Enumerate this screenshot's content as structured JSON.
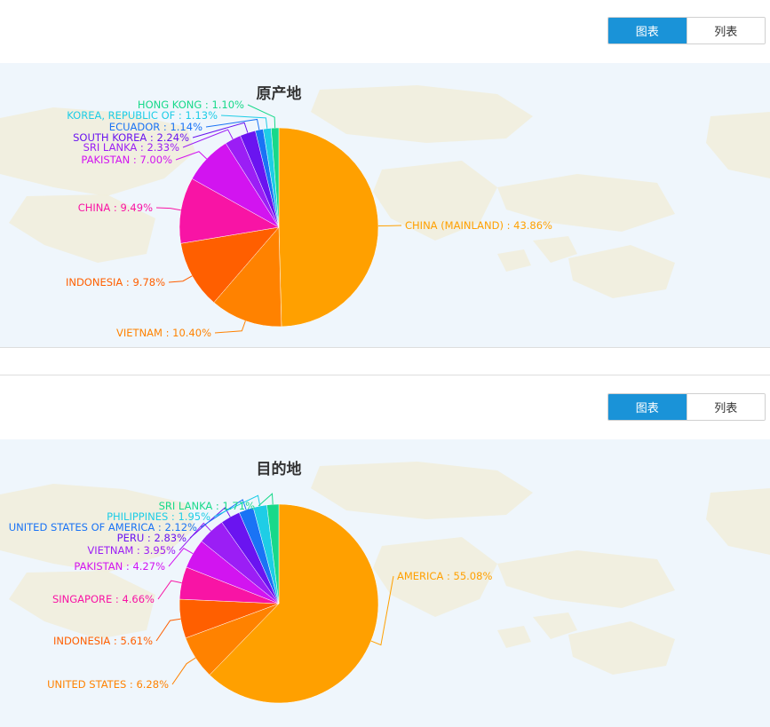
{
  "view_toggle": {
    "chart_label": "图表",
    "list_label": "列表"
  },
  "colors": {
    "accent": "#1a93d8",
    "panel_bg": "#eff6fc",
    "map_land": "#f1eedd"
  },
  "chart_data": [
    {
      "type": "pie",
      "title": "原产地",
      "slices": [
        {
          "label": "CHINA (MAINLAND)",
          "value": 43.86,
          "display": "CHINA (MAINLAND) : 43.86%",
          "color": "#ffa000"
        },
        {
          "label": "VIETNAM",
          "value": 10.4,
          "display": "VIETNAM : 10.40%",
          "color": "#ff8200"
        },
        {
          "label": "INDONESIA",
          "value": 9.78,
          "display": "INDONESIA : 9.78%",
          "color": "#ff5f00"
        },
        {
          "label": "CHINA",
          "value": 9.49,
          "display": "CHINA : 9.49%",
          "color": "#f814a5"
        },
        {
          "label": "PAKISTAN",
          "value": 7.0,
          "display": "PAKISTAN : 7.00%",
          "color": "#d214f0"
        },
        {
          "label": "SRI LANKA",
          "value": 2.33,
          "display": "SRI LANKA : 2.33%",
          "color": "#9b1ef5"
        },
        {
          "label": "SOUTH KOREA",
          "value": 2.24,
          "display": "SOUTH KOREA : 2.24%",
          "color": "#6a14f0"
        },
        {
          "label": "ECUADOR",
          "value": 1.14,
          "display": "ECUADOR : 1.14%",
          "color": "#1a73f5"
        },
        {
          "label": "KOREA, REPUBLIC OF",
          "value": 1.13,
          "display": "KOREA, REPUBLIC OF : 1.13%",
          "color": "#1ecde6"
        },
        {
          "label": "HONG KONG",
          "value": 1.1,
          "display": "HONG KONG : 1.10%",
          "color": "#17d98a"
        }
      ]
    },
    {
      "type": "pie",
      "title": "目的地",
      "slices": [
        {
          "label": "AMERICA",
          "value": 55.08,
          "display": "AMERICA : 55.08%",
          "color": "#ffa000"
        },
        {
          "label": "UNITED STATES",
          "value": 6.28,
          "display": "UNITED STATES : 6.28%",
          "color": "#ff8200"
        },
        {
          "label": "INDONESIA",
          "value": 5.61,
          "display": "INDONESIA : 5.61%",
          "color": "#ff5f00"
        },
        {
          "label": "SINGAPORE",
          "value": 4.66,
          "display": "SINGAPORE : 4.66%",
          "color": "#f814a5"
        },
        {
          "label": "PAKISTAN",
          "value": 4.27,
          "display": "PAKISTAN : 4.27%",
          "color": "#d214f0"
        },
        {
          "label": "VIETNAM",
          "value": 3.95,
          "display": "VIETNAM : 3.95%",
          "color": "#9b1ef5"
        },
        {
          "label": "PERU",
          "value": 2.83,
          "display": "PERU : 2.83%",
          "color": "#6a14f0"
        },
        {
          "label": "UNITED STATES OF AMERICA",
          "value": 2.12,
          "display": "UNITED STATES OF AMERICA : 2.12%",
          "color": "#1a73f5"
        },
        {
          "label": "PHILIPPINES",
          "value": 1.95,
          "display": "PHILIPPINES : 1.95%",
          "color": "#1ecde6"
        },
        {
          "label": "SRI LANKA",
          "value": 1.71,
          "display": "SRI LANKA : 1.71%",
          "color": "#17d98a"
        }
      ]
    }
  ]
}
